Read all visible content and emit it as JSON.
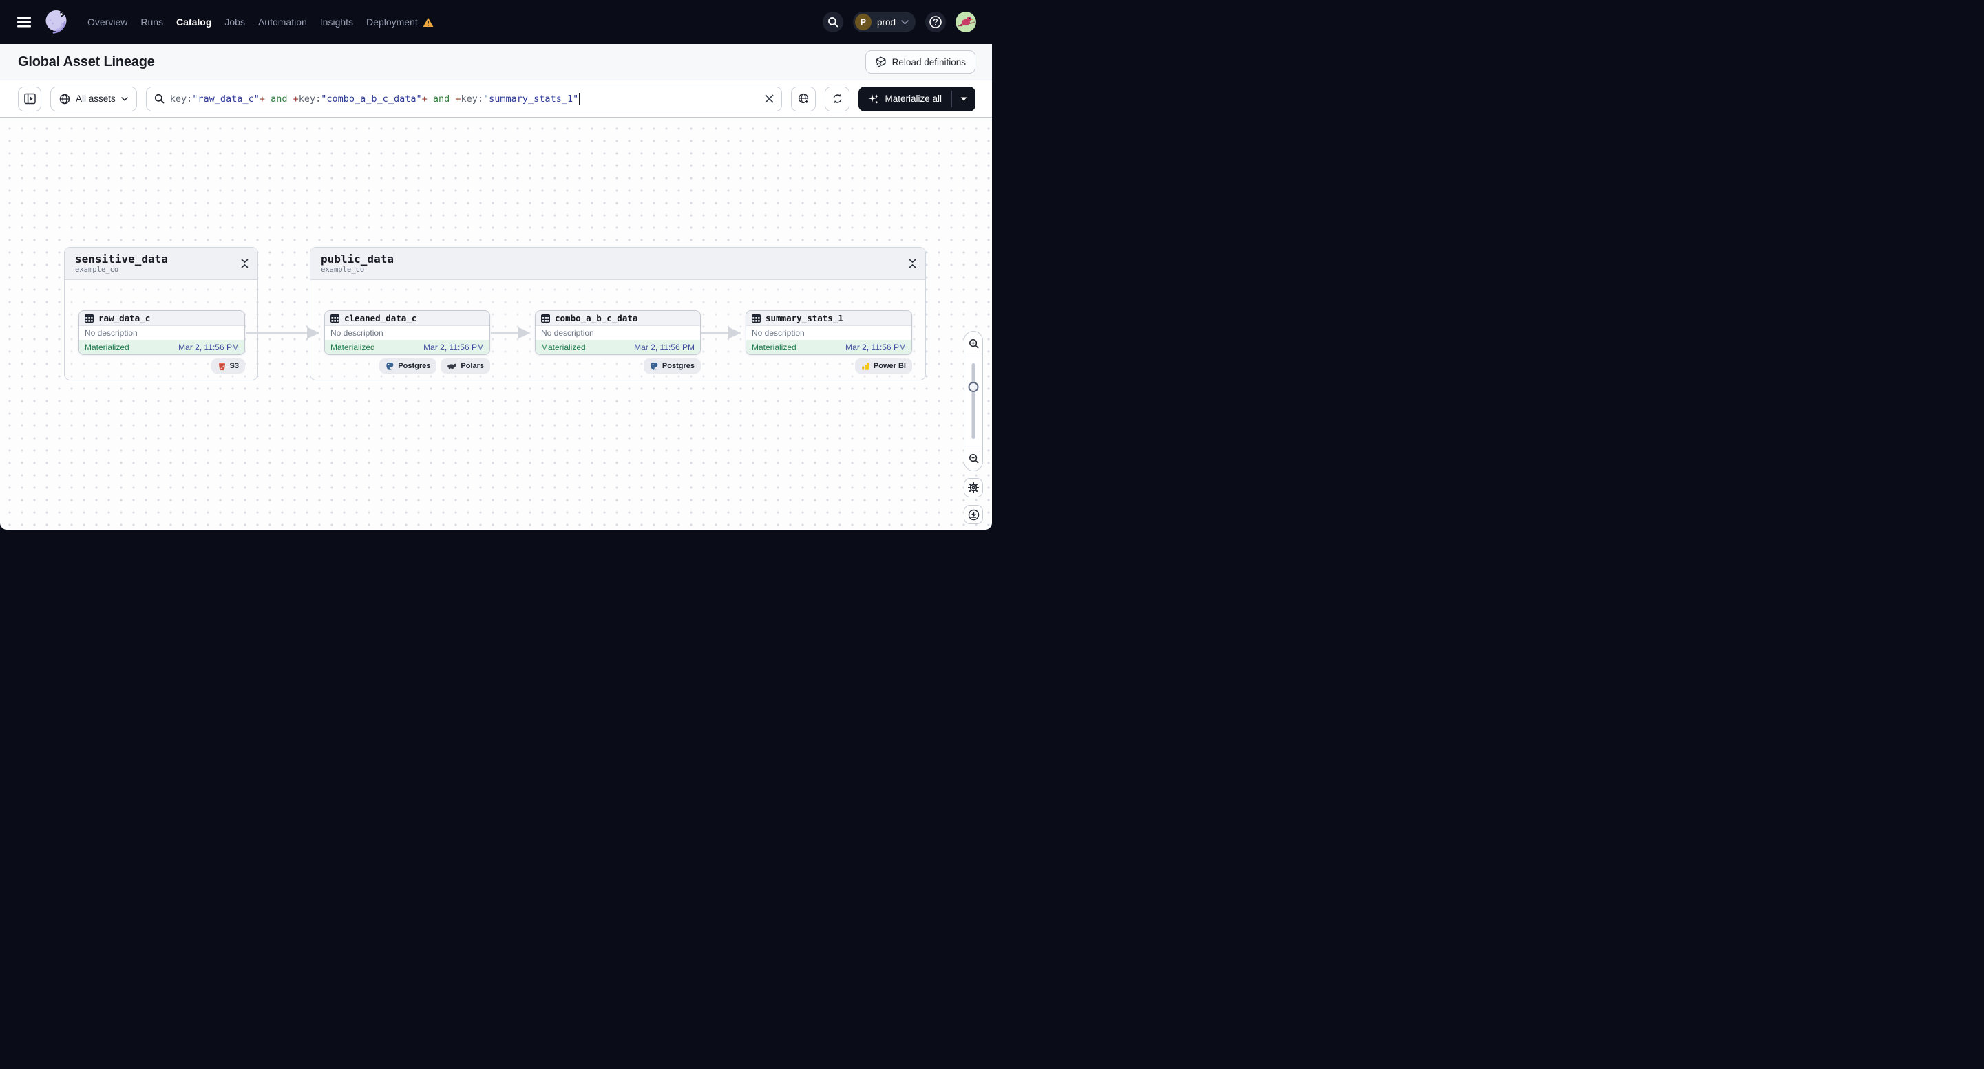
{
  "navbar": {
    "menu": [
      "Overview",
      "Runs",
      "Catalog",
      "Jobs",
      "Automation",
      "Insights",
      "Deployment"
    ],
    "deployment": {
      "initial": "P",
      "name": "prod"
    }
  },
  "page": {
    "title": "Global Asset Lineage",
    "reload_button": "Reload definitions"
  },
  "filterbar": {
    "scope_button": "All assets",
    "query": {
      "segments": [
        "key:",
        "\"raw_data_c\"",
        "+",
        " and ",
        "+",
        "key:",
        "\"combo_a_b_c_data\"",
        "+",
        " and ",
        "+",
        "key:",
        "\"summary_stats_1\""
      ]
    },
    "materialize_button": "Materialize all"
  },
  "graph": {
    "groups": [
      {
        "name": "sensitive_data",
        "repo": "example_co"
      },
      {
        "name": "public_data",
        "repo": "example_co"
      }
    ],
    "nodes": [
      {
        "name": "raw_data_c",
        "description": "No description",
        "status": "Materialized",
        "materialized_at": "Mar 2, 11:56 PM",
        "badges": [
          "S3"
        ]
      },
      {
        "name": "cleaned_data_c",
        "description": "No description",
        "status": "Materialized",
        "materialized_at": "Mar 2, 11:56 PM",
        "badges": [
          "Postgres",
          "Polars"
        ]
      },
      {
        "name": "combo_a_b_c_data",
        "description": "No description",
        "status": "Materialized",
        "materialized_at": "Mar 2, 11:56 PM",
        "badges": [
          "Postgres"
        ]
      },
      {
        "name": "summary_stats_1",
        "description": "No description",
        "status": "Materialized",
        "materialized_at": "Mar 2, 11:56 PM",
        "badges": [
          "Power BI"
        ]
      }
    ]
  },
  "colors": {
    "status_green": "#217a4c",
    "timestamp_blue": "#3f4b9e",
    "warning_orange": "#eda73e",
    "materialize_bg": "#10141f"
  }
}
